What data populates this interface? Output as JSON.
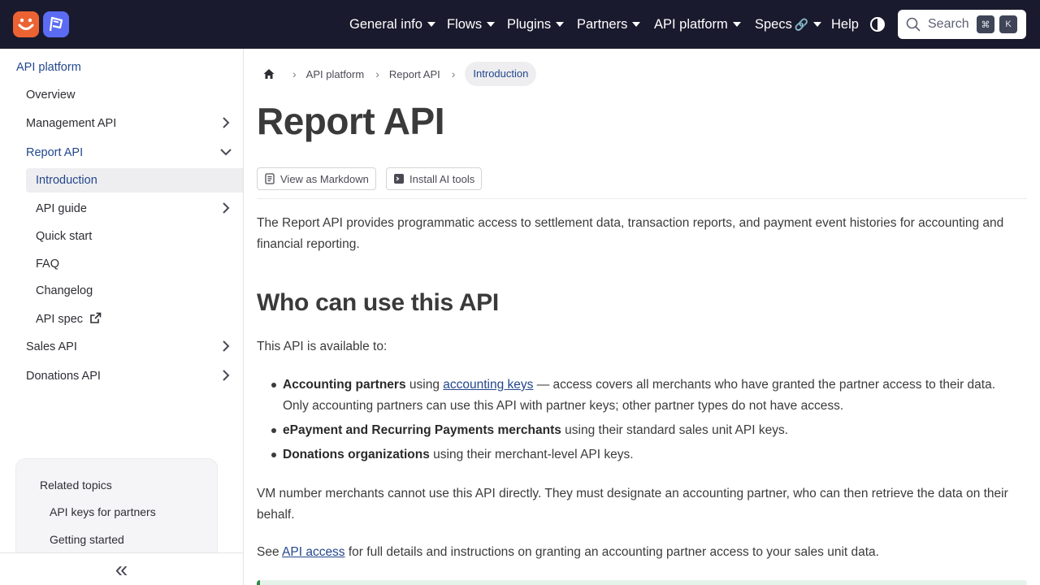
{
  "topbar": {
    "nav": [
      {
        "label": "General info",
        "has_menu": true
      },
      {
        "label": "Flows",
        "has_menu": true
      },
      {
        "label": "Plugins",
        "has_menu": true
      },
      {
        "label": "Partners",
        "has_menu": true
      },
      {
        "label": "API platform",
        "has_menu": true
      },
      {
        "label": "Specs",
        "has_menu": true,
        "external_glyph": "🔗"
      },
      {
        "label": "Help",
        "has_menu": false
      }
    ],
    "search": {
      "label": "Search",
      "shortcut": [
        "⌘",
        "K"
      ]
    },
    "icons": [
      "smiley-logo-icon",
      "flag-logo-icon",
      "theme-toggle-icon",
      "search-icon"
    ]
  },
  "sidebar": {
    "section_title": "API platform",
    "items": [
      {
        "label": "Overview",
        "expandable": false
      },
      {
        "label": "Management API",
        "expandable": true,
        "expanded": false
      },
      {
        "label": "Report API",
        "expandable": true,
        "expanded": true
      },
      {
        "label": "Introduction",
        "selected": true
      },
      {
        "label": "API guide",
        "expandable": true,
        "expanded": false
      },
      {
        "label": "Quick start"
      },
      {
        "label": "FAQ"
      },
      {
        "label": "Changelog"
      },
      {
        "label": "API spec",
        "external": true
      },
      {
        "label": "Sales API",
        "expandable": true,
        "expanded": false
      },
      {
        "label": "Donations API",
        "expandable": true,
        "expanded": false
      }
    ],
    "related": {
      "title": "Related topics",
      "items": [
        "API keys for partners",
        "Getting started"
      ]
    },
    "collapse_glyph": "«"
  },
  "breadcrumb": [
    "API platform",
    "Report API",
    "Introduction"
  ],
  "page": {
    "title": "Report API",
    "tools": [
      "View as Markdown",
      "Install AI tools"
    ],
    "intro": "The Report API provides programmatic access to settlement data, transaction reports, and payment event histories for accounting and financial reporting.",
    "section_title": "Who can use this API",
    "available_to": "This API is available to:",
    "bullets": [
      {
        "bold": "Accounting partners",
        "pre": " using ",
        "link": "accounting keys",
        "post": " — access covers all merchants who have granted the partner access to their data. Only accounting partners can use this API with partner keys; other partner types do not have access."
      },
      {
        "bold": "ePayment and Recurring Payments merchants",
        "post": " using their standard sales unit API keys."
      },
      {
        "bold": "Donations organizations",
        "post": " using their merchant-level API keys."
      }
    ],
    "vm_note": "VM number merchants cannot use this API directly. They must designate an accounting partner, who can then retrieve the data on their behalf.",
    "see": {
      "pre": "See ",
      "link": "API access",
      "post": " for full details and instructions on granting an accounting partner access to your sales unit data."
    }
  },
  "colors": {
    "topbar_bg": "#1a1a2e",
    "logo_orange": "#ec6333",
    "logo_blue": "#5b6cf2",
    "accent_link": "#23478c",
    "callout_green": "#2b8a4a"
  }
}
